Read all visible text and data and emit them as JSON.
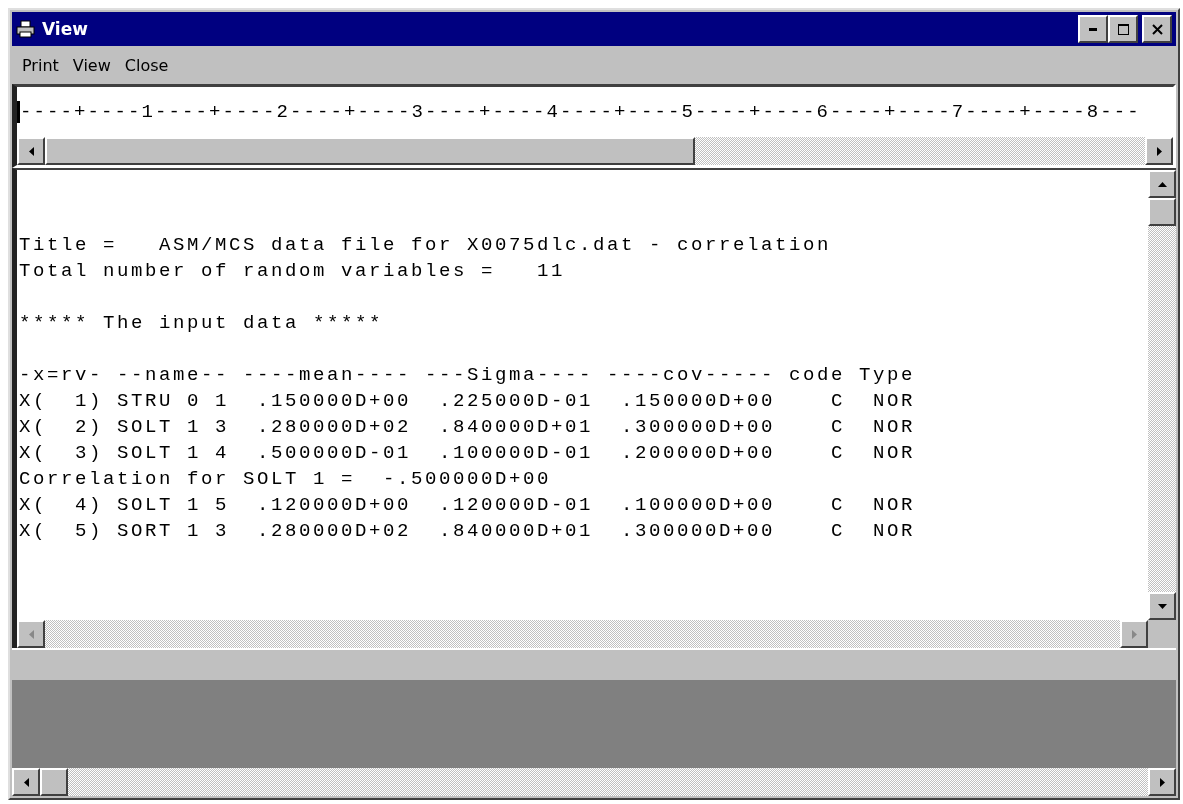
{
  "window": {
    "title": "View"
  },
  "menu": [
    {
      "label": "Print"
    },
    {
      "label": "View"
    },
    {
      "label": "Close"
    }
  ],
  "ruler": "----+----1----+----2----+----3----+----4----+----5----+----6----+----7----+----8---",
  "paragraphs": [
    [
      "Title =   ASM/MCS data file for X0075dlc.dat - correlation",
      "Total number of random variables =   11"
    ],
    [
      "***** The input data *****"
    ],
    [
      "-x=rv- --name-- ----mean---- ---Sigma---- ----cov----- code Type",
      "X(  1) STRU 0 1  .150000D+00  .225000D-01  .150000D+00    C  NOR",
      "X(  2) SOLT 1 3  .280000D+02  .840000D+01  .300000D+00    C  NOR",
      "X(  3) SOLT 1 4  .500000D-01  .100000D-01  .200000D+00    C  NOR",
      "Correlation for SOLT 1 =  -.500000D+00",
      "X(  4) SOLT 1 5  .120000D+00  .120000D-01  .100000D+00    C  NOR",
      "X(  5) SORT 1 3  .280000D+02  .840000D+01  .300000D+00    C  NOR"
    ]
  ]
}
